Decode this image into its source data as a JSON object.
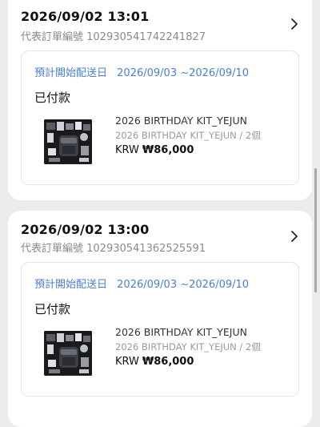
{
  "orders": [
    {
      "date": "2026/09/02 13:01",
      "order_number": "代表訂單編號 102930541742241827",
      "delivery_label": "預計開始配送日",
      "delivery_range": "2026/09/03 ~2026/09/10",
      "status": "已付款",
      "product_name": "2026 BIRTHDAY KIT_YEJUN",
      "product_option": "2026 BIRTHDAY KIT_YEJUN / 2個",
      "price_currency": "KRW",
      "price_value": "₩86,000"
    },
    {
      "date": "2026/09/02 13:00",
      "order_number": "代表訂單編號 102930541362525591",
      "delivery_label": "預計開始配送日",
      "delivery_range": "2026/09/03 ~2026/09/10",
      "status": "已付款",
      "product_name": "2026 BIRTHDAY KIT_YEJUN",
      "product_option": "2026 BIRTHDAY KIT_YEJUN / 2個",
      "price_currency": "KRW",
      "price_value": "₩86,000"
    }
  ],
  "icons": {
    "chevron": "chevron-right-icon",
    "thumbnail": "product-thumbnail"
  },
  "colors": {
    "background": "#ececef",
    "card": "#ffffff",
    "delivery_accent": "#4a7fd0",
    "muted_text": "#8a8a8f"
  }
}
